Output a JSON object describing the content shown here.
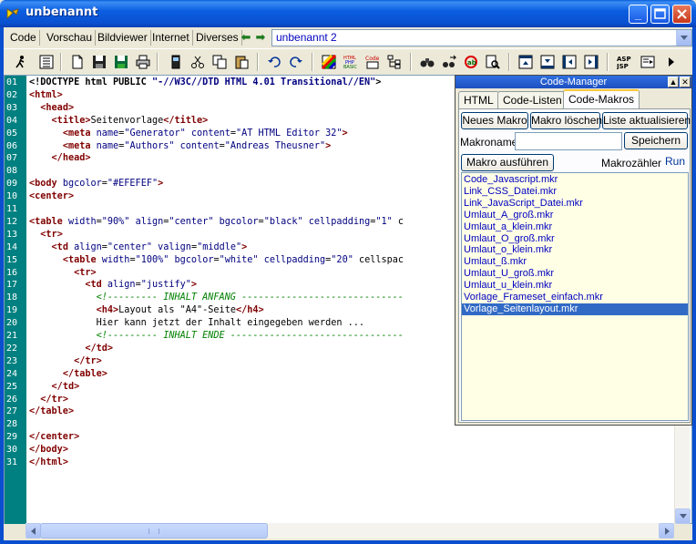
{
  "window": {
    "title": "unbenannt"
  },
  "menu_tabs": [
    {
      "label": "Code"
    },
    {
      "label": "Vorschau"
    },
    {
      "label": "Bildviewer"
    },
    {
      "label": "Internet"
    },
    {
      "label": "Diverses"
    }
  ],
  "document_select": {
    "value": "unbenannt 2"
  },
  "toolbar_icons": [
    "run-icon",
    "list-icon",
    "new-file-icon",
    "save-icon",
    "save-all-icon",
    "print-icon",
    "phone-icon",
    "cut-icon",
    "copy-icon",
    "paste-icon",
    "undo-icon",
    "redo-icon",
    "color-palette-icon",
    "html-php-basic-icon",
    "code-icon",
    "tree-icon",
    "find-icon",
    "find-next-icon",
    "replace-icon",
    "search-doc-icon",
    "window-top-icon",
    "window-bottom-icon",
    "window-left-icon",
    "window-right-icon",
    "asp-jsp-icon",
    "macro-icon",
    "play-icon"
  ],
  "editor": {
    "line_numbers": [
      "01",
      "02",
      "03",
      "04",
      "05",
      "06",
      "07",
      "08",
      "09",
      "10",
      "11",
      "12",
      "13",
      "14",
      "15",
      "16",
      "17",
      "18",
      "19",
      "20",
      "21",
      "22",
      "23",
      "24",
      "25",
      "26",
      "27",
      "28",
      "29",
      "30",
      "31"
    ],
    "lines": [
      "<!DOCTYPE html PUBLIC \"-//W3C//DTD HTML 4.01 Transitional//EN\">",
      "<html>",
      "  <head>",
      "    <title>Seitenvorlage</title>",
      "      <meta name=\"Generator\" content=\"AT HTML Editor 32\">",
      "      <meta name=\"Authors\" content=\"Andreas Theusner\">",
      "    </head>",
      "",
      "<body bgcolor=\"#EFEFEF\">",
      "<center>",
      "",
      "<table width=\"90%\" align=\"center\" bgcolor=\"black\" cellpadding=\"1\" c",
      "  <tr>",
      "    <td align=\"center\" valign=\"middle\">",
      "      <table width=\"100%\" bgcolor=\"white\" cellpadding=\"20\" cellspac",
      "        <tr>",
      "          <td align=\"justify\">",
      "            <!--------- INHALT ANFANG -----------------------------",
      "            <h4>Layout als \"A4\"-Seite</h4>",
      "            Hier kann jetzt der Inhalt eingegeben werden ...",
      "            <!--------- INHALT ENDE -------------------------------",
      "          </td>",
      "        </tr>",
      "      </table>",
      "    </td>",
      "  </tr>",
      "</table>",
      "",
      "</center>",
      "</body>",
      "</html>"
    ]
  },
  "code_manager": {
    "title": "Code-Manager",
    "tabs": [
      {
        "label": "HTML"
      },
      {
        "label": "Code-Listen"
      },
      {
        "label": "Code-Makros"
      }
    ],
    "buttons": {
      "new_macro": "Neues Makro",
      "delete_macro": "Makro löschen",
      "refresh_list": "Liste aktualisieren",
      "save": "Speichern",
      "run_macro": "Makro ausführen"
    },
    "macro_name_label": "Makroname",
    "macro_name_value": "",
    "counter_label": "Makrozähler",
    "run_label": "Run",
    "macros": [
      "Code_Javascript.mkr",
      "Link_CSS_Datei.mkr",
      "Link_JavaScript_Datei.mkr",
      "Umlaut_A_groß.mkr",
      "Umlaut_a_klein.mkr",
      "Umlaut_O_groß.mkr",
      "Umlaut_o_klein.mkr",
      "Umlaut_ß.mkr",
      "Umlaut_U_groß.mkr",
      "Umlaut_u_klein.mkr",
      "Vorlage_Frameset_einfach.mkr",
      "Vorlage_Seitenlayout.mkr"
    ],
    "selected_macro": "Vorlage_Seitenlayout.mkr"
  }
}
